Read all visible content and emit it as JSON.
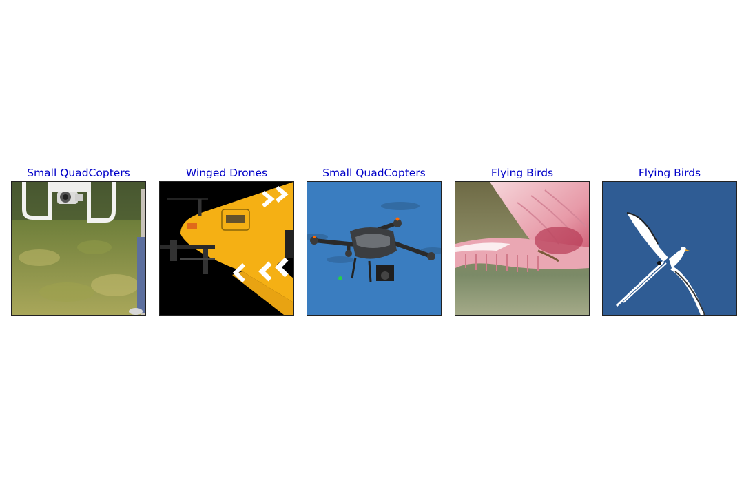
{
  "colors": {
    "title": "#0000c8",
    "frame": "#222222"
  },
  "panels": [
    {
      "title": "Small QuadCopters",
      "image": "quadcopter-over-grass-photo"
    },
    {
      "title": "Winged Drones",
      "image": "yellow-winged-drone-photo"
    },
    {
      "title": "Small QuadCopters",
      "image": "quadcopter-blue-sky-photo"
    },
    {
      "title": "Flying Birds",
      "image": "pink-spoonbill-wing-photo"
    },
    {
      "title": "Flying Birds",
      "image": "white-tropicbird-photo"
    }
  ]
}
